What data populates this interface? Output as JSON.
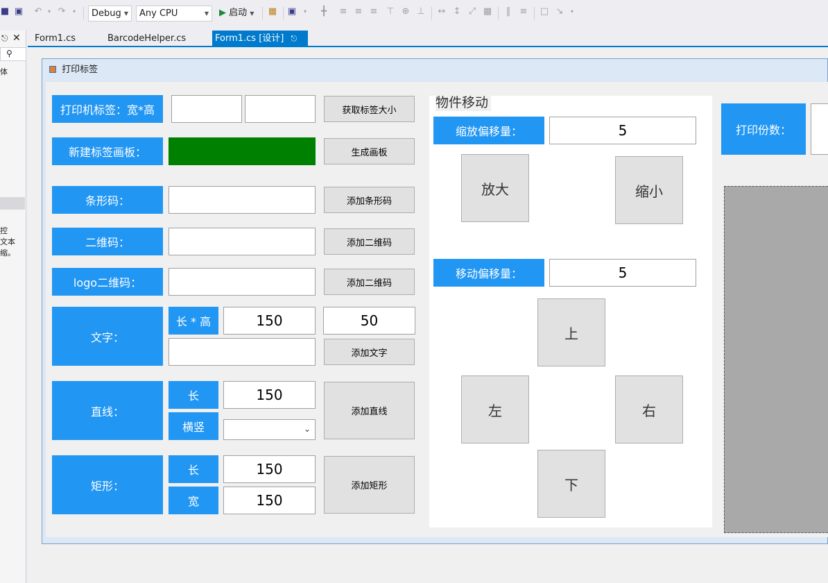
{
  "toolbar": {
    "config": "Debug",
    "platform": "Any CPU",
    "start_label": "启动"
  },
  "left_panel": {
    "line1": "体",
    "line2": "控",
    "line3": "文本",
    "line4": "缩。"
  },
  "tabs": [
    {
      "label": "Form1.cs",
      "active": false
    },
    {
      "label": "BarcodeHelper.cs",
      "active": false
    },
    {
      "label": "Form1.cs [设计]",
      "active": true
    }
  ],
  "form": {
    "title": "打印标签",
    "label_size_label": "打印机标签：宽*高",
    "label_width": "",
    "label_height": "",
    "get_size_button": "获取标签大小",
    "new_canvas_label": "新建标签画板：",
    "create_canvas_button": "生成画板",
    "barcode_label": "条形码：",
    "barcode_value": "",
    "add_barcode_button": "添加条形码",
    "qrcode_label": "二维码：",
    "qrcode_value": "",
    "add_qrcode_button": "添加二维码",
    "logo_qrcode_label": "logo二维码：",
    "logo_qrcode_value": "",
    "add_logo_qrcode_button": "添加二维码",
    "text_label": "文字：",
    "text_size_label": "长 * 高",
    "text_length": "150",
    "text_height": "50",
    "text_value": "",
    "add_text_button": "添加文字",
    "line_label": "直线：",
    "line_length_label": "长",
    "line_length": "150",
    "line_orient_label": "横竖",
    "line_orient_value": "",
    "add_line_button": "添加直线",
    "rect_label": "矩形：",
    "rect_length_label": "长",
    "rect_length": "150",
    "rect_width_label": "宽",
    "rect_width": "150",
    "add_rect_button": "添加矩形",
    "move_group": {
      "title": "物件移动",
      "scale_offset_label": "缩放偏移量：",
      "scale_offset": "5",
      "zoom_in_button": "放大",
      "zoom_out_button": "缩小",
      "move_offset_label": "移动偏移量：",
      "move_offset": "5",
      "up_button": "上",
      "left_button": "左",
      "right_button": "右",
      "down_button": "下"
    },
    "copies_label": "打印份数：",
    "copies_value": ""
  },
  "colors": {
    "label_blue": "#2196f3",
    "canvas_green": "#008000",
    "accent": "#007acc",
    "preview_gray": "#a9a9a9"
  }
}
